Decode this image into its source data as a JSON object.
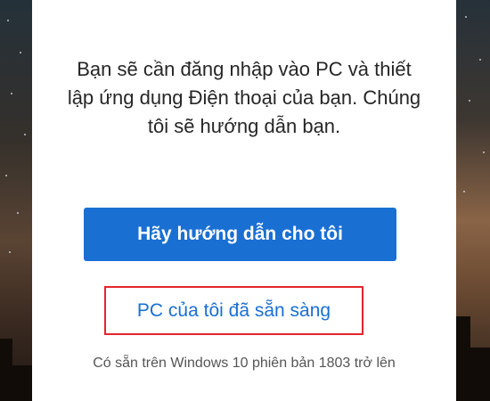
{
  "setup": {
    "message_lines": [
      "Bạn sẽ cần đăng nhập vào PC và thiết",
      "lập ứng dụng Điện thoại của bạn. Chúng",
      "tôi sẽ hướng dẫn bạn."
    ],
    "guide_button_label": "Hãy hướng dẫn cho tôi",
    "ready_link_label": "PC của tôi đã sẵn sàng",
    "footnote": "Có sẵn trên Windows 10 phiên bản 1803 trở lên"
  },
  "colors": {
    "primary": "#1a6fd3",
    "highlight": "#e3262c",
    "card_background": "#ffffff",
    "text": "#262626",
    "muted_text": "#555555"
  }
}
